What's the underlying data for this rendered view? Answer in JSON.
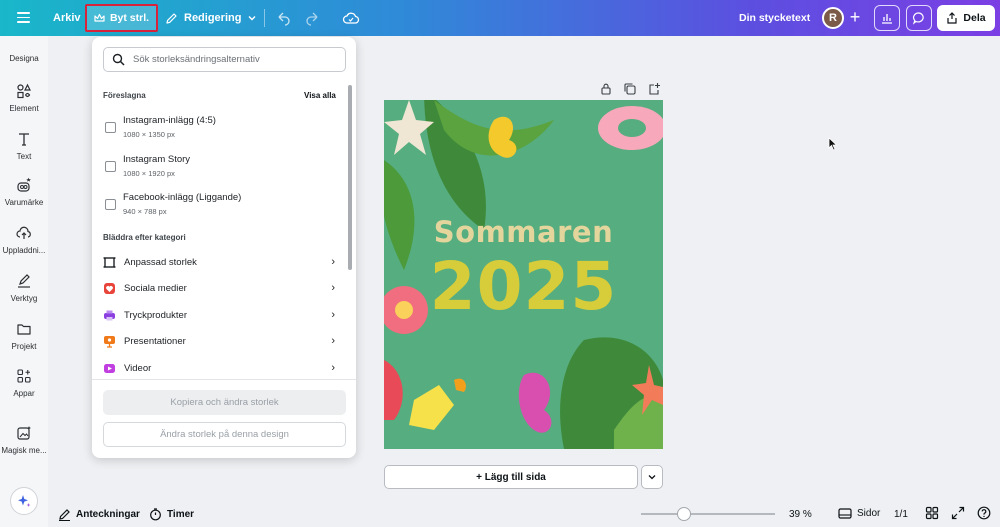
{
  "topbar": {
    "file_label": "Arkiv",
    "resize_label": "Byt strl.",
    "edit_label": "Redigering",
    "doc_title": "Din stycketext",
    "avatar_initial": "R",
    "share_label": "Dela"
  },
  "sidebar": {
    "items": [
      {
        "label": "Designa",
        "icon": "design-icon"
      },
      {
        "label": "Element",
        "icon": "elements-icon"
      },
      {
        "label": "Text",
        "icon": "text-icon"
      },
      {
        "label": "Varumärke",
        "icon": "brand-icon"
      },
      {
        "label": "Uppladdni...",
        "icon": "upload-icon"
      },
      {
        "label": "Verktyg",
        "icon": "draw-icon"
      },
      {
        "label": "Projekt",
        "icon": "folder-icon"
      },
      {
        "label": "Appar",
        "icon": "apps-icon"
      },
      {
        "label": "Magisk me...",
        "icon": "magic-media-icon"
      }
    ]
  },
  "resize_panel": {
    "search_placeholder": "Sök storleksändringsalternativ",
    "suggested_heading": "Föreslagna",
    "see_all": "Visa alla",
    "suggestions": [
      {
        "name": "Instagram-inlägg (4:5)",
        "size": "1080 × 1350 px"
      },
      {
        "name": "Instagram Story",
        "size": "1080 × 1920 px"
      },
      {
        "name": "Facebook-inlägg (Liggande)",
        "size": "940 × 788 px"
      }
    ],
    "browse_heading": "Bläddra efter kategori",
    "categories": [
      {
        "label": "Anpassad storlek",
        "icon": "custom-size-icon",
        "color": "#0d1216"
      },
      {
        "label": "Sociala medier",
        "icon": "heart-icon",
        "color": "#e8443a"
      },
      {
        "label": "Tryckprodukter",
        "icon": "printer-icon",
        "color": "#8b3fe0"
      },
      {
        "label": "Presentationer",
        "icon": "presentation-icon",
        "color": "#f07a1a"
      },
      {
        "label": "Videor",
        "icon": "video-icon",
        "color": "#c13ee0"
      }
    ],
    "copy_resize_label": "Kopiera och ändra storlek",
    "resize_this_label": "Ändra storlek på denna design"
  },
  "canvas": {
    "design_title_line1": "Sommaren",
    "design_title_line2": "2025",
    "add_page_label": "+ Lägg till sida"
  },
  "bottombar": {
    "notes_label": "Anteckningar",
    "timer_label": "Timer",
    "zoom_value": "39 %",
    "zoom_fraction": 0.32,
    "pages_label": "Sidor",
    "page_count": "1/1"
  },
  "colors": {
    "highlight_border": "#d8233b",
    "share_bg": "#ffffff",
    "design_bg": "#56ad7f"
  }
}
